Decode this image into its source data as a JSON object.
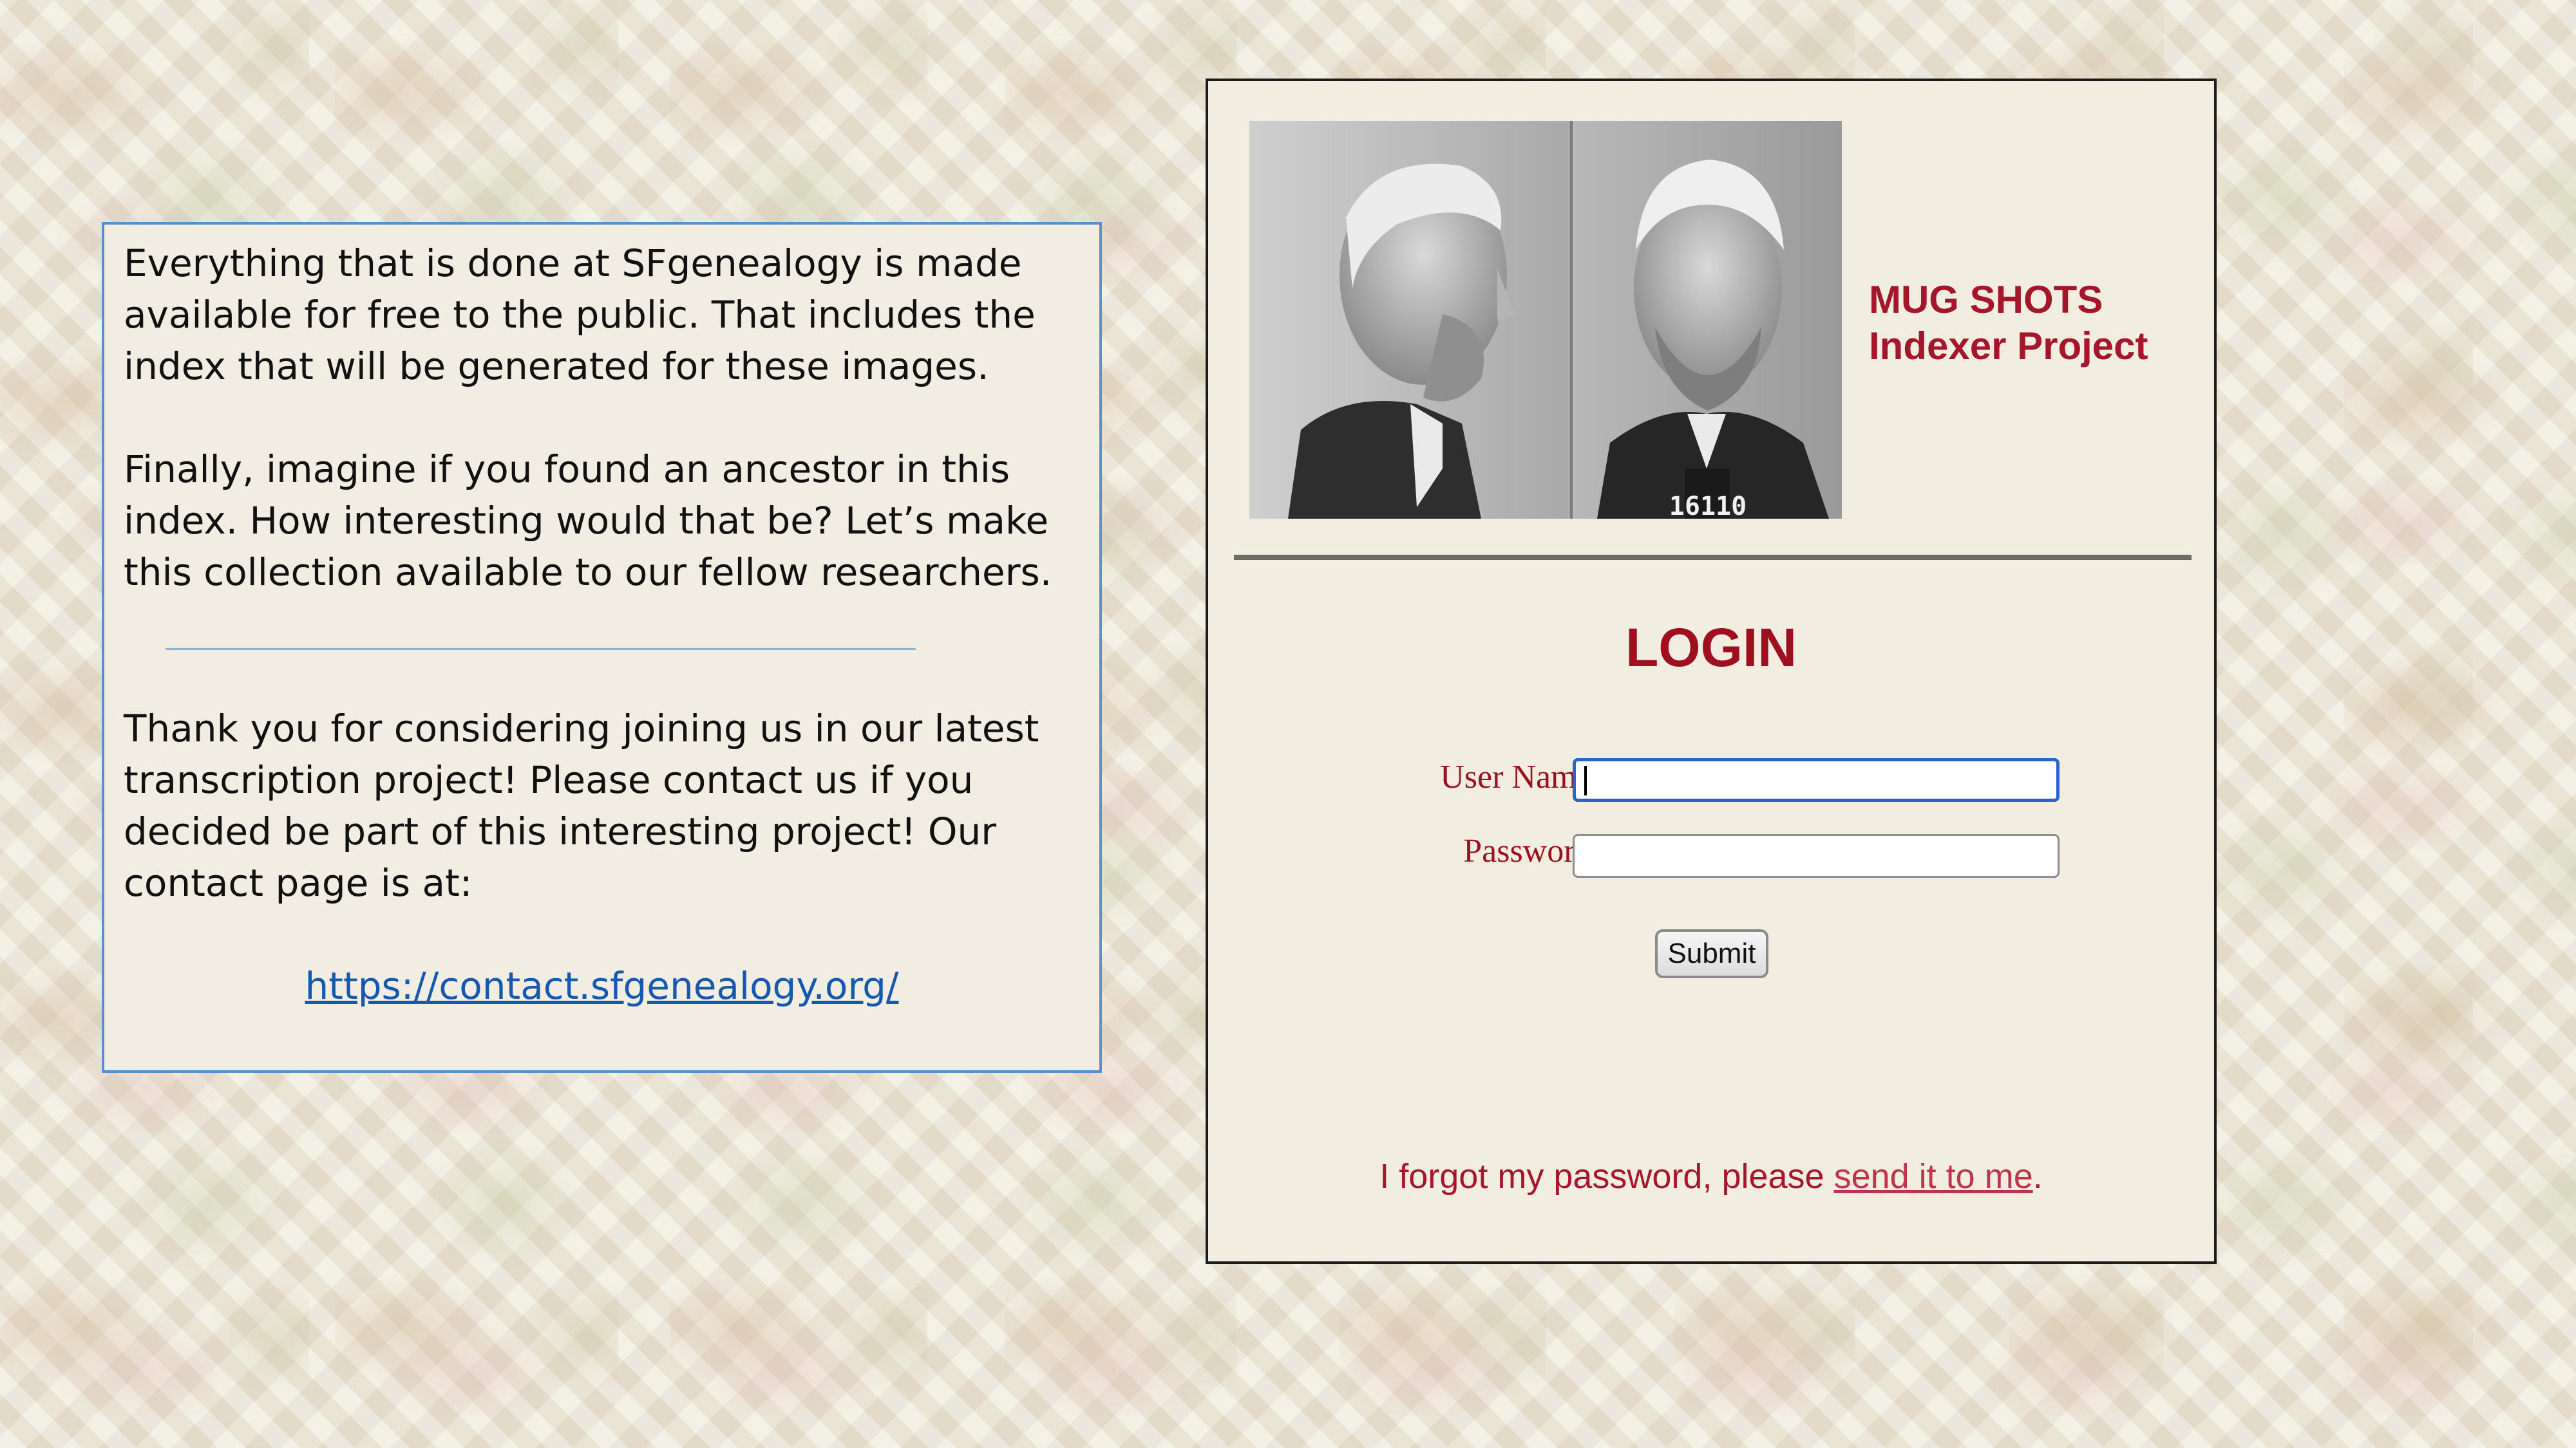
{
  "info": {
    "paragraph1": "Everything that is done at SFgenealogy is made available for free to the public. That includes the index that will be generated for these images.",
    "paragraph2": "Finally, imagine if you found an ancestor in this index. How interesting would that be? Let’s make this collection available to our fellow researchers.",
    "paragraph3": "Thank you for considering joining us in our latest transcription project! Please contact us if you decided be part of this interesting project! Our contact page is at:",
    "contact_url": "https://contact.sfgenealogy.org/"
  },
  "login": {
    "title_line1": "MUG SHOTS",
    "title_line2": "Indexer Project",
    "heading": "LOGIN",
    "user_label": "User Name:",
    "user_value": "",
    "password_label": "Password:",
    "password_value": "",
    "submit_label": "Submit",
    "forgot_prefix": "I forgot my password, please ",
    "forgot_link": "send it to me",
    "forgot_suffix": ".",
    "photo_tag_text": "16110"
  },
  "colors": {
    "accent_red": "#a5162a",
    "link_blue": "#1558b0",
    "box_border_blue": "#5b8fc7"
  }
}
